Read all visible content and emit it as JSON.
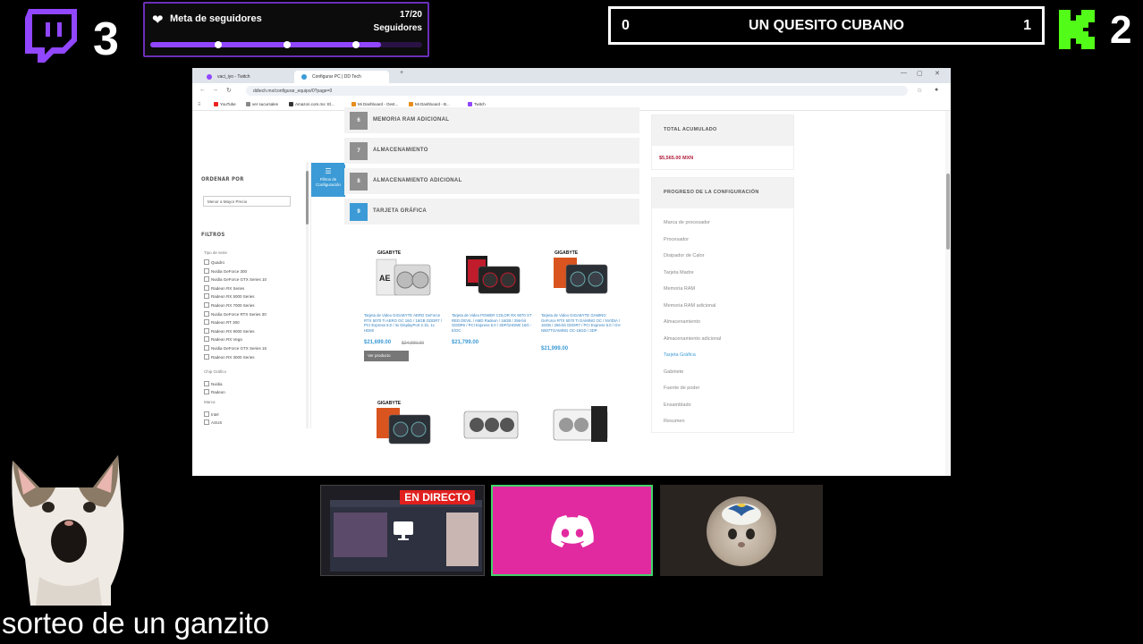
{
  "overlay": {
    "twitch_count": "3",
    "kick_count": "2",
    "follower_goal": {
      "title": "Meta de seguidores",
      "count": "17/20",
      "unit": "Seguidores",
      "progress_fraction": 0.85
    },
    "scoreboard": {
      "left_score": "0",
      "title": "UN QUESITO CUBANO",
      "right_score": "1"
    },
    "caption": "sorteo de un ganzito",
    "colors": {
      "twitch_purple": "#9146ff",
      "kick_green": "#53fc18",
      "discord_pink": "#e22aa0",
      "live_red": "#e0201f"
    }
  },
  "browser": {
    "tabs": [
      {
        "label": "vaci_iyo - Twitch",
        "favicon_color": "#9146ff"
      },
      {
        "label": "Configurar PC | DD Tech",
        "favicon_color": "#3c9bd6"
      }
    ],
    "url": "ddtech.mx/configurar_equipo/0?page=0",
    "bookmarks": [
      "YouTube",
      "ver sucursales",
      "Amazon.com.mx: El...",
      "Mi Dashboard - Oest...",
      "Mi Dashboard - B...",
      "Twitch"
    ],
    "sidebar": {
      "sort_heading": "ORDENAR POR",
      "sort_value": "Menor a Mayor Precio",
      "filters_heading": "FILTROS",
      "series_group": "Tipo de serie",
      "series_items": [
        "Quadro",
        "Nvidia GeForce 300",
        "Nvidia GeForce GTX Series 10",
        "Radeon RX Series",
        "Radeon RX 5000 Series",
        "Radeon RX 7000 Series",
        "Nvidia GeForce RTX Series 30",
        "Radeon RT 300",
        "Radeon RX 9000 Series",
        "Radeon RX Vega",
        "Nvidia GeForce GTX Series 16",
        "Radeon RX 3000 Series"
      ],
      "chip_group": "Chip Gráfico",
      "chip_items": [
        "Nvidia",
        "Radeon"
      ],
      "other_group": "Marca",
      "other_items": [
        "Intel",
        "ASUS"
      ],
      "filter_button": "Filtros de Configuración"
    },
    "steps": [
      {
        "num": "6",
        "label": "MEMORIA RAM ADICIONAL",
        "active": false
      },
      {
        "num": "7",
        "label": "ALMACENAMIENTO",
        "active": false
      },
      {
        "num": "8",
        "label": "ALMACENAMIENTO ADICIONAL",
        "active": false
      },
      {
        "num": "9",
        "label": "TARJETA GRÁFICA",
        "active": true
      }
    ],
    "products": [
      {
        "title": "Tarjeta de Video GIGABYTE AERO GeForce RTX 5070 Ti AERO OC 16G / 16GB GDDR7 / PCI Express 5.0 / 3x DisplayPort 2.1b, 1x HDMI",
        "price": "$21,699.00",
        "old_price": "$24,999.00",
        "button": "Ver producto"
      },
      {
        "title": "Tarjeta de Video POWER COLOR RX 9070 XT RED DEVIL / AMD Radeon / 16GB / 256-bit GDDR6 / PCI Express 5.0 / 3DP/1HDMI/ 16G - E/OC",
        "price": "$21,799.00"
      },
      {
        "title": "Tarjeta de Video GIGABYTE GAMING GeForce RTX 5070 Ti GAMING OC / NVIDIA / 16GB / 256-bit GDDR7 / PCI Express 5.0 / GV-N507TGAMING OC-16GD / 3DP",
        "price": "$21,999.00"
      },
      {
        "title": ""
      },
      {
        "title": ""
      },
      {
        "title": ""
      }
    ],
    "right_panel": {
      "total_heading": "TOTAL ACUMULADO",
      "total_value": "$5,565.00 MXN",
      "progress_heading": "PROGRESO DE LA CONFIGURACIÓN",
      "progress_items": [
        "Marca de procesador",
        "Procesador",
        "Disipador de Calor",
        "Tarjeta Madre",
        "Memoria RAM",
        "Memoria RAM adicional",
        "Almacenamiento",
        "Almacenamiento adicional",
        "Tarjeta Gráfica",
        "Gabinete",
        "Fuente de poder",
        "Ensamblado",
        "Resumen"
      ],
      "active_item_index": 8
    }
  },
  "thumbnails": {
    "live_badge": "EN DIRECTO"
  }
}
